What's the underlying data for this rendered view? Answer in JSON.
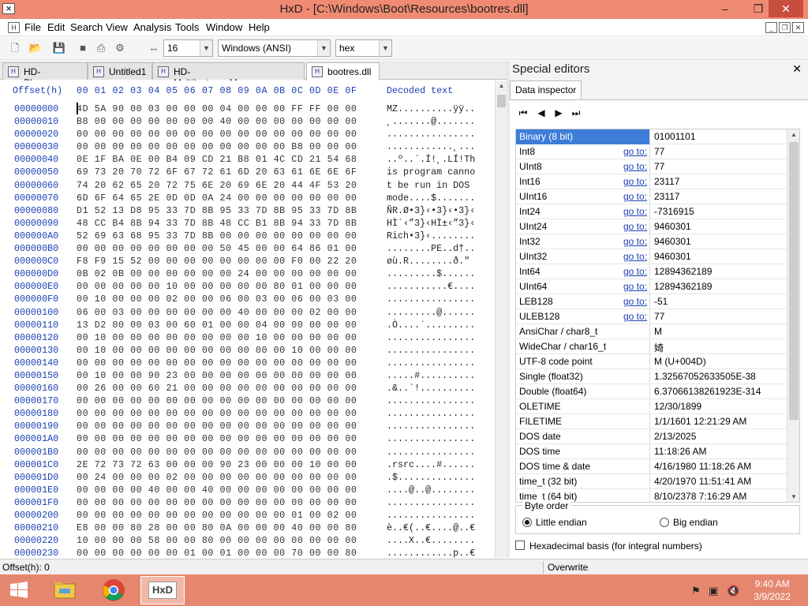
{
  "window": {
    "title": "HxD - [C:\\Windows\\Boot\\Resources\\bootres.dll]",
    "app_icon": "HxD",
    "minimize": "–",
    "restore": "❐",
    "close": "✕"
  },
  "menu": {
    "items": [
      "File",
      "Edit",
      "Search",
      "View",
      "Analysis",
      "Tools",
      "Window",
      "Help"
    ],
    "mdi_minimize": "_",
    "mdi_restore": "❐",
    "mdi_close": "✕"
  },
  "toolbar": {
    "bytes_per_row": "16",
    "charset": "Windows (ANSI)",
    "offset_base": "hex"
  },
  "tabs": [
    {
      "label": "HD-Player.exe"
    },
    {
      "label": "Untitled1"
    },
    {
      "label": "HD-MultiInstanceManager.exe"
    },
    {
      "label": "bootres.dll",
      "active": true
    }
  ],
  "editor": {
    "header_offset": "Offset(h)",
    "header_columns": "00 01 02 03 04 05 06 07 08 09 0A 0B 0C 0D 0E 0F",
    "header_decoded": "Decoded text",
    "rows": [
      {
        "offset": "00000000",
        "hex": "4D 5A 90 00 03 00 00 00 04 00 00 00 FF FF 00 00",
        "text": "MZ..........ÿÿ.."
      },
      {
        "offset": "00000010",
        "hex": "B8 00 00 00 00 00 00 00 40 00 00 00 00 00 00 00",
        "text": "¸.......@......."
      },
      {
        "offset": "00000020",
        "hex": "00 00 00 00 00 00 00 00 00 00 00 00 00 00 00 00",
        "text": "................"
      },
      {
        "offset": "00000030",
        "hex": "00 00 00 00 00 00 00 00 00 00 00 00 B8 00 00 00",
        "text": "............¸..."
      },
      {
        "offset": "00000040",
        "hex": "0E 1F BA 0E 00 B4 09 CD 21 B8 01 4C CD 21 54 68",
        "text": "..º..´.Í!¸.LÍ!Th"
      },
      {
        "offset": "00000050",
        "hex": "69 73 20 70 72 6F 67 72 61 6D 20 63 61 6E 6E 6F",
        "text": "is program canno"
      },
      {
        "offset": "00000060",
        "hex": "74 20 62 65 20 72 75 6E 20 69 6E 20 44 4F 53 20",
        "text": "t be run in DOS "
      },
      {
        "offset": "00000070",
        "hex": "6D 6F 64 65 2E 0D 0D 0A 24 00 00 00 00 00 00 00",
        "text": "mode....$......."
      },
      {
        "offset": "00000080",
        "hex": "D1 52 13 D8 95 33 7D 8B 95 33 7D 8B 95 33 7D 8B",
        "text": "ÑR.Ø•3}‹•3}‹•3}‹"
      },
      {
        "offset": "00000090",
        "hex": "48 CC B4 8B 94 33 7D 8B 48 CC B1 8B 94 33 7D 8B",
        "text": "HÌ´‹”3}‹HÌ±‹”3}‹"
      },
      {
        "offset": "000000A0",
        "hex": "52 69 63 68 95 33 7D 8B 00 00 00 00 00 00 00 00",
        "text": "Rich•3}‹........"
      },
      {
        "offset": "000000B0",
        "hex": "00 00 00 00 00 00 00 00 50 45 00 00 64 86 01 00",
        "text": "........PE..d†.."
      },
      {
        "offset": "000000C0",
        "hex": "F8 F9 15 52 00 00 00 00 00 00 00 00 F0 00 22 20",
        "text": "øù.R........ð.\" "
      },
      {
        "offset": "000000D0",
        "hex": "0B 02 0B 00 00 00 00 00 00 24 00 00 00 00 00 00",
        "text": ".........$......"
      },
      {
        "offset": "000000E0",
        "hex": "00 00 00 00 00 10 00 00 00 00 00 80 01 00 00 00",
        "text": "...........€...."
      },
      {
        "offset": "000000F0",
        "hex": "00 10 00 00 00 02 00 00 06 00 03 00 06 00 03 00",
        "text": "................"
      },
      {
        "offset": "00000100",
        "hex": "06 00 03 00 00 00 00 00 00 40 00 00 00 02 00 00",
        "text": ".........@......"
      },
      {
        "offset": "00000110",
        "hex": "13 D2 00 00 03 00 60 01 00 00 04 00 00 00 00 00",
        "text": ".Ò....`........."
      },
      {
        "offset": "00000120",
        "hex": "00 10 00 00 00 00 00 00 00 00 10 00 00 00 00 00",
        "text": "................"
      },
      {
        "offset": "00000130",
        "hex": "00 10 00 00 00 00 00 00 00 00 00 00 10 00 00 00",
        "text": "................"
      },
      {
        "offset": "00000140",
        "hex": "00 00 00 00 00 00 00 00 00 00 00 00 00 00 00 00",
        "text": "................"
      },
      {
        "offset": "00000150",
        "hex": "00 10 00 00 90 23 00 00 00 00 00 00 00 00 00 00",
        "text": ".....#.........."
      },
      {
        "offset": "00000160",
        "hex": "00 26 00 00 60 21 00 00 00 00 00 00 00 00 00 00",
        "text": ".&..`!.........."
      },
      {
        "offset": "00000170",
        "hex": "00 00 00 00 00 00 00 00 00 00 00 00 00 00 00 00",
        "text": "................"
      },
      {
        "offset": "00000180",
        "hex": "00 00 00 00 00 00 00 00 00 00 00 00 00 00 00 00",
        "text": "................"
      },
      {
        "offset": "00000190",
        "hex": "00 00 00 00 00 00 00 00 00 00 00 00 00 00 00 00",
        "text": "................"
      },
      {
        "offset": "000001A0",
        "hex": "00 00 00 00 00 00 00 00 00 00 00 00 00 00 00 00",
        "text": "................"
      },
      {
        "offset": "000001B0",
        "hex": "00 00 00 00 00 00 00 00 00 00 00 00 00 00 00 00",
        "text": "................"
      },
      {
        "offset": "000001C0",
        "hex": "2E 72 73 72 63 00 00 00 90 23 00 00 00 10 00 00",
        "text": ".rsrc....#......"
      },
      {
        "offset": "000001D0",
        "hex": "00 24 00 00 00 02 00 00 00 00 00 00 00 00 00 00",
        "text": ".$.............."
      },
      {
        "offset": "000001E0",
        "hex": "00 00 00 00 40 00 00 40 00 00 00 00 00 00 00 00",
        "text": "....@..@........"
      },
      {
        "offset": "000001F0",
        "hex": "00 00 00 00 00 00 00 00 00 00 00 00 00 00 00 00",
        "text": "................"
      },
      {
        "offset": "00000200",
        "hex": "00 00 00 00 00 00 00 00 00 00 00 00 01 00 02 00",
        "text": "................"
      },
      {
        "offset": "00000210",
        "hex": "E8 00 00 80 28 00 00 80 0A 00 00 00 40 00 00 80",
        "text": "è..€(..€....@..€"
      },
      {
        "offset": "00000220",
        "hex": "10 00 00 00 58 00 00 80 00 00 00 00 00 00 00 00",
        "text": "....X..€........"
      },
      {
        "offset": "00000230",
        "hex": "00 00 00 00 00 00 01 00 01 00 00 00 70 00 00 80",
        "text": "............p..€"
      }
    ]
  },
  "side": {
    "title": "Special editors",
    "close": "✕",
    "tab": "Data inspector",
    "nav": [
      "⏮",
      "◀",
      "▶",
      "⏭"
    ],
    "goto_label": "go to:",
    "rows": [
      {
        "name": "Binary (8 bit)",
        "value": "01001101",
        "goto": false,
        "selected": true
      },
      {
        "name": "Int8",
        "value": "77",
        "goto": true
      },
      {
        "name": "UInt8",
        "value": "77",
        "goto": true
      },
      {
        "name": "Int16",
        "value": "23117",
        "goto": true
      },
      {
        "name": "UInt16",
        "value": "23117",
        "goto": true
      },
      {
        "name": "Int24",
        "value": "-7316915",
        "goto": true
      },
      {
        "name": "UInt24",
        "value": "9460301",
        "goto": true
      },
      {
        "name": "Int32",
        "value": "9460301",
        "goto": true
      },
      {
        "name": "UInt32",
        "value": "9460301",
        "goto": true
      },
      {
        "name": "Int64",
        "value": "12894362189",
        "goto": true
      },
      {
        "name": "UInt64",
        "value": "12894362189",
        "goto": true
      },
      {
        "name": "LEB128",
        "value": "-51",
        "goto": true
      },
      {
        "name": "ULEB128",
        "value": "77",
        "goto": true
      },
      {
        "name": "AnsiChar / char8_t",
        "value": "M",
        "goto": false
      },
      {
        "name": "WideChar / char16_t",
        "value": "婍",
        "goto": false
      },
      {
        "name": "UTF-8 code point",
        "value": "M (U+004D)",
        "goto": false
      },
      {
        "name": "Single (float32)",
        "value": "1.32567052633505E-38",
        "goto": false
      },
      {
        "name": "Double (float64)",
        "value": "6.37066138261923E-314",
        "goto": false
      },
      {
        "name": "OLETIME",
        "value": "12/30/1899",
        "goto": false
      },
      {
        "name": "FILETIME",
        "value": "1/1/1601 12:21:29 AM",
        "goto": false
      },
      {
        "name": "DOS date",
        "value": "2/13/2025",
        "goto": false
      },
      {
        "name": "DOS time",
        "value": "11:18:26 AM",
        "goto": false
      },
      {
        "name": "DOS time & date",
        "value": "4/16/1980 11:18:26 AM",
        "goto": false
      },
      {
        "name": "time_t (32 bit)",
        "value": "4/20/1970 11:51:41 AM",
        "goto": false
      },
      {
        "name": "time_t (64 bit)",
        "value": "8/10/2378 7:16:29 AM",
        "goto": false
      }
    ],
    "byte_order": {
      "legend": "Byte order",
      "little": "Little endian",
      "big": "Big endian",
      "selected": "little"
    },
    "hex_basis": "Hexadecimal basis (for integral numbers)"
  },
  "status": {
    "offset": "Offset(h): 0",
    "mode": "Overwrite"
  },
  "taskbar": {
    "time": "9:40 AM",
    "date": "3/9/2022",
    "hxd_label": "HxD"
  },
  "colors": {
    "titlebar": "#f08a72",
    "taskbar": "#e5876f",
    "offset_blue": "#1a3fb5",
    "selection": "#3d7dd8"
  }
}
